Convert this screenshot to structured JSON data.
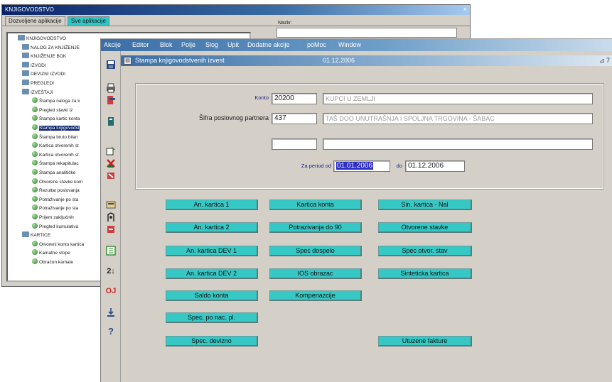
{
  "back_window": {
    "title": "KNJIGOVODSTVO",
    "tabs": [
      "Dozvoljene aplikacije",
      "Sve aplikacije"
    ],
    "right_label": "Naziv:",
    "tree": [
      {
        "label": "KNJIGOVODSTVO",
        "kind": "folder"
      },
      {
        "label": "NALOG ZA KNJIŽENJE",
        "kind": "folder"
      },
      {
        "label": "KNJIŽENJE BOK",
        "kind": "folder"
      },
      {
        "label": "IZVODI",
        "kind": "folder"
      },
      {
        "label": "DEVIZNI IZVODI",
        "kind": "folder"
      },
      {
        "label": "PREGLEDI",
        "kind": "folder"
      },
      {
        "label": "IZVEŠTAJI",
        "kind": "folder"
      },
      {
        "label": "Štampa naloga za k",
        "kind": "item"
      },
      {
        "label": "Pregled stavki iz",
        "kind": "item"
      },
      {
        "label": "Štampa kartic konta",
        "kind": "item"
      },
      {
        "label": "Štampa knjigovodst",
        "kind": "item"
      },
      {
        "label": "Štampa bruto bilan",
        "kind": "item"
      },
      {
        "label": "Kartica otvorenih st",
        "kind": "item"
      },
      {
        "label": "Kartica otvorenih st",
        "kind": "item"
      },
      {
        "label": "Štampa rekapitulac",
        "kind": "item"
      },
      {
        "label": "Štampa analitičke",
        "kind": "item"
      },
      {
        "label": "Otvorene stavke kom",
        "kind": "item"
      },
      {
        "label": "Rezultat poslovanja",
        "kind": "item"
      },
      {
        "label": "Potraživanje po sta",
        "kind": "item"
      },
      {
        "label": "Potraživanje po sta",
        "kind": "item"
      },
      {
        "label": "Prijem zaključnih",
        "kind": "item"
      },
      {
        "label": "Pregled kumulativa",
        "kind": "item"
      },
      {
        "label": "KARTICE",
        "kind": "folder"
      },
      {
        "label": "Otvoreni konto kartica",
        "kind": "item"
      },
      {
        "label": "Kamatne stope",
        "kind": "item"
      },
      {
        "label": "Obračun kamate",
        "kind": "item"
      }
    ]
  },
  "menubar": {
    "items": [
      "Akcije",
      "Editor",
      "Blok",
      "Polje",
      "Slog",
      "Upit",
      "Dodatne akcije",
      "poMoc",
      "Window"
    ]
  },
  "inner_window": {
    "title": "Stampa knjigovodstvenih izvest",
    "date": "01.12.2006",
    "controls": "⊿ 7"
  },
  "form": {
    "konto_label": "Konto",
    "konto_value": "20200",
    "konto_name": "KUPCI U ZEMLJI",
    "partner_label": "Šifra poslovnog partnera",
    "partner_value": "437",
    "partner_name": "TAŠ DOO UNUTRAŠNJA I SPOLJNA TRGOVINA - ŠABAC",
    "extra_value": "",
    "extra_name": "",
    "period_label": "Za period od",
    "period_from": "01.01.2006",
    "period_to_label": "do",
    "period_to": "01.12.2006"
  },
  "buttons": {
    "col1": [
      "An. kartica 1",
      "An. kartica 2",
      "An. kartica DEV 1",
      "An. kartica DEV 2",
      "Saldo konta",
      "Spec. po nac. pl.",
      "Spec. devizno"
    ],
    "col2": [
      "Kartica konta",
      "Potrazivanja do 90",
      "Spec dospelo",
      "IOS obrazac",
      "Kompenazcije"
    ],
    "col3": [
      "Sin. kartica - Nal",
      "Otvorene stavke",
      "Spec otvor. stav",
      "Sinteticka kartica",
      "Utuzene fakture"
    ]
  },
  "colors": {
    "button_bg": "#36c8c4",
    "window_bg": "#d4d0c8",
    "title_gradient_start": "#3a6ea5"
  }
}
